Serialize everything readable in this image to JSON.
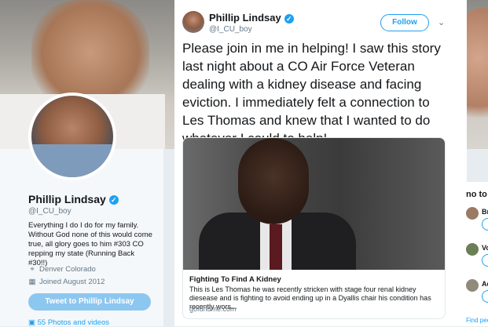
{
  "profile": {
    "name": "Phillip Lindsay",
    "verified_glyph": "✓",
    "handle": "@I_CU_boy",
    "bio": "Everything I do I do for my family. Without God none of this would come true, all glory goes to him #303 CO repping my state (Running Back #30!!)",
    "location": "Denver Colorado",
    "joined": "Joined August 2012",
    "tweet_to_label": "Tweet to Phillip Lindsay",
    "photos_label": "55 Photos and videos"
  },
  "tweet": {
    "name": "Phillip Lindsay",
    "verified_glyph": "✓",
    "handle": "@I_CU_boy",
    "follow_label": "Follow",
    "text": "Please join in me in helping! I saw this story last night about a CO Air Force Veteran dealing with a kidney disease and facing eviction. I immediately felt a connection to Les Thomas and knew that I wanted to do whatever I could to help!",
    "link": {
      "title": "Fighting To Find A Kidney",
      "description": "This is Les Thomas he was recently stricken with stage four renal kidney diesease and is fighting to avoid ending up in a Dyallis chair his condition has recently wors...",
      "domain": "gofundme.com"
    }
  },
  "right_column": {
    "title": "no to f",
    "items": [
      {
        "name": "Br"
      },
      {
        "name": "Vo"
      },
      {
        "name": "Ad"
      }
    ],
    "find_people": "Find peo"
  },
  "icons": {
    "location": "location-pin-icon",
    "calendar": "calendar-icon",
    "photos": "photo-icon",
    "chevron": "chevron-down-icon"
  },
  "colors": {
    "accent": "#1da1f2",
    "tweet_to_button": "#8cc7f0",
    "secondary_text": "#657786"
  }
}
